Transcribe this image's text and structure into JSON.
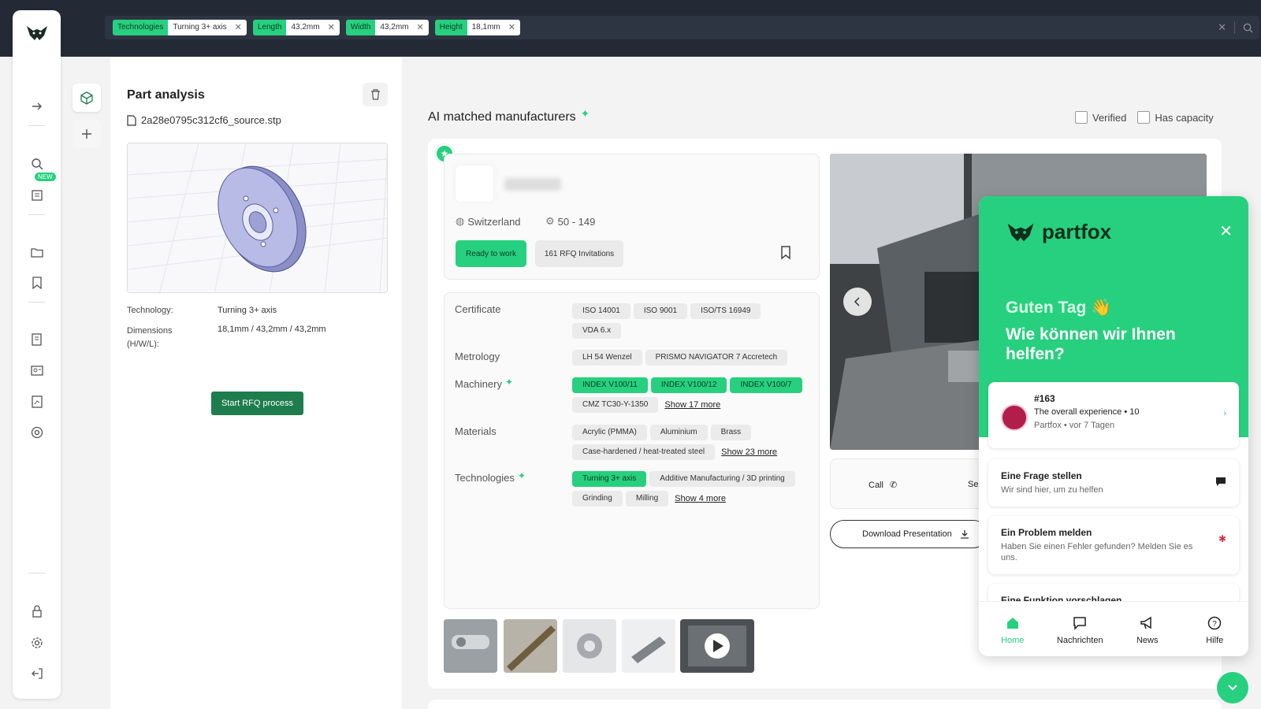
{
  "filters": [
    {
      "key": "Technologies",
      "value": "Turning 3+ axis"
    },
    {
      "key": "Length",
      "value": "43,2mm"
    },
    {
      "key": "Width",
      "value": "43,2mm"
    },
    {
      "key": "Height",
      "value": "18,1mm"
    }
  ],
  "rail": {
    "new_badge": "NEW"
  },
  "part": {
    "title": "Part analysis",
    "file": "2a28e0795c312cf6_source.stp",
    "technology_label": "Technology:",
    "technology_value": "Turning 3+ axis",
    "dimensions_label": "Dimensions (H/W/L):",
    "dimensions_value": "18,1mm / 43,2mm / 43,2mm",
    "rfq_button": "Start RFQ process"
  },
  "matches": {
    "title": "AI matched manufacturers",
    "verified": "Verified",
    "has_capacity": "Has capacity"
  },
  "manufacturer": {
    "country": "Switzerland",
    "employees": "50 - 149",
    "ready": "Ready to work",
    "invitations": "161 RFQ Invitations",
    "certificate_label": "Certificate",
    "certificates": [
      "ISO 14001",
      "ISO 9001",
      "ISO/TS 16949",
      "VDA 6.x"
    ],
    "metrology_label": "Metrology",
    "metrology": [
      "LH 54 Wenzel",
      "PRISMO NAVIGATOR 7 Accretech"
    ],
    "machinery_label": "Machinery",
    "machinery_matched": [
      "INDEX V100/11",
      "INDEX V100/12",
      "INDEX V100/7"
    ],
    "machinery": [
      "CMZ TC30-Y-1350"
    ],
    "machinery_more": "Show 17 more",
    "materials_label": "Materials",
    "materials": [
      "Acrylic (PMMA)",
      "Aluminium",
      "Brass",
      "Case-hardened / heat-treated steel"
    ],
    "materials_more": "Show 23 more",
    "technologies_label": "Technologies",
    "technologies_matched": [
      "Turning 3+ axis"
    ],
    "technologies": [
      "Additive Manufacturing / 3D printing",
      "Grinding",
      "Milling"
    ],
    "technologies_more": "Show 4 more",
    "call": "Call",
    "send_partial": "Se",
    "download": "Download Presentation"
  },
  "widget": {
    "brand": "partfox",
    "greeting": "Guten Tag 👋",
    "question": "Wie können wir Ihnen helfen?",
    "conversation": {
      "id": "#163",
      "text": "The overall experience • 10",
      "meta": "Partfox • vor 7 Tagen"
    },
    "ask": {
      "title": "Eine Frage stellen",
      "sub": "Wir sind hier, um zu helfen"
    },
    "report": {
      "title": "Ein Problem melden",
      "sub": "Haben Sie einen Fehler gefunden? Melden Sie es uns."
    },
    "suggest": {
      "title": "Eine Funktion vorschlagen"
    },
    "tabs": [
      "Home",
      "Nachrichten",
      "News",
      "Hilfe"
    ]
  },
  "colors": {
    "accent": "#27d07e",
    "topbar": "#232a36",
    "dark_green": "#1e7d4d"
  }
}
